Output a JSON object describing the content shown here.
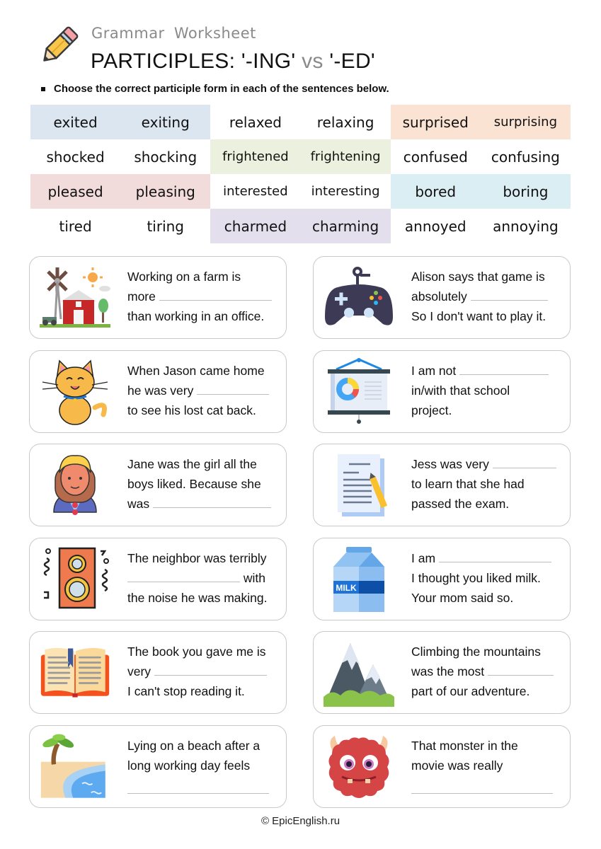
{
  "header": {
    "subtitle": "Grammar  Worksheet",
    "title_part1": "PARTICIPLES: '-ING'",
    "title_vs": "vs",
    "title_part2": "'-ED'",
    "icon": "pencil-icon"
  },
  "instruction": "Choose the correct participle form in each of the sentences below.",
  "word_bank": {
    "rows": [
      [
        {
          "word": "exited",
          "color": "#dce6f1"
        },
        {
          "word": "exiting",
          "color": "#dce6f1"
        },
        {
          "word": "relaxed",
          "color": "#ffffff"
        },
        {
          "word": "relaxing",
          "color": "#ffffff"
        },
        {
          "word": "surprised",
          "color": "#fbe3d4"
        },
        {
          "word": "surprising",
          "color": "#fbe3d4"
        }
      ],
      [
        {
          "word": "shocked",
          "color": "#ffffff"
        },
        {
          "word": "shocking",
          "color": "#ffffff"
        },
        {
          "word": "frightened",
          "color": "#ebf1de"
        },
        {
          "word": "frightening",
          "color": "#ebf1de"
        },
        {
          "word": "confused",
          "color": "#ffffff"
        },
        {
          "word": "confusing",
          "color": "#ffffff"
        }
      ],
      [
        {
          "word": "pleased",
          "color": "#f2dcdb"
        },
        {
          "word": "pleasing",
          "color": "#f2dcdb"
        },
        {
          "word": "interested",
          "color": "#ffffff"
        },
        {
          "word": "interesting",
          "color": "#ffffff"
        },
        {
          "word": "bored",
          "color": "#daeef3"
        },
        {
          "word": "boring",
          "color": "#daeef3"
        }
      ],
      [
        {
          "word": "tired",
          "color": "#ffffff"
        },
        {
          "word": "tiring",
          "color": "#ffffff"
        },
        {
          "word": "charmed",
          "color": "#e4dfec"
        },
        {
          "word": "charming",
          "color": "#e4dfec"
        },
        {
          "word": "annoyed",
          "color": "#ffffff"
        },
        {
          "word": "annoying",
          "color": "#ffffff"
        }
      ]
    ]
  },
  "exercises": [
    {
      "icon": "farm-icon",
      "lines": [
        [
          "Working on a farm is"
        ],
        [
          "more ",
          "_"
        ],
        [
          "than working in an office."
        ]
      ]
    },
    {
      "icon": "gamepad-icon",
      "lines": [
        [
          "Alison says that game is"
        ],
        [
          "absolutely ",
          "_"
        ],
        [
          "So I don't want to play it."
        ]
      ]
    },
    {
      "icon": "cat-icon",
      "lines": [
        [
          "When Jason came home"
        ],
        [
          "he was very ",
          "_"
        ],
        [
          "to see his lost cat back."
        ]
      ]
    },
    {
      "icon": "presentation-board-icon",
      "lines": [
        [
          "I am not ",
          "_"
        ],
        [
          "in/with that school"
        ],
        [
          "project."
        ]
      ]
    },
    {
      "icon": "girl-icon",
      "lines": [
        [
          "Jane was the girl all the"
        ],
        [
          "boys liked. Because she"
        ],
        [
          "was ",
          "_"
        ]
      ]
    },
    {
      "icon": "document-pencil-icon",
      "lines": [
        [
          "Jess was very ",
          "_"
        ],
        [
          "to learn that she had"
        ],
        [
          "passed the exam."
        ]
      ]
    },
    {
      "icon": "speaker-icon",
      "lines": [
        [
          "The neighbor was terribly"
        ],
        [
          "_",
          " with"
        ],
        [
          "the noise he was making."
        ]
      ]
    },
    {
      "icon": "milk-carton-icon",
      "lines": [
        [
          "I am ",
          "_"
        ],
        [
          "I thought you liked milk."
        ],
        [
          "Your mom said so."
        ]
      ]
    },
    {
      "icon": "open-book-icon",
      "lines": [
        [
          "The book you gave me is"
        ],
        [
          "very ",
          "_"
        ],
        [
          "I can't stop reading it."
        ]
      ]
    },
    {
      "icon": "mountain-icon",
      "lines": [
        [
          "Climbing the mountains"
        ],
        [
          "was the most ",
          "_"
        ],
        [
          "part of our adventure."
        ]
      ]
    },
    {
      "icon": "beach-icon",
      "lines": [
        [
          "Lying on a beach after a"
        ],
        [
          "long working day feels"
        ],
        [
          "_"
        ]
      ]
    },
    {
      "icon": "monster-icon",
      "lines": [
        [
          "That monster in the"
        ],
        [
          "movie was really"
        ],
        [
          "_"
        ]
      ]
    }
  ],
  "milk_label": "MILK",
  "footer": "© EpicEnglish.ru"
}
